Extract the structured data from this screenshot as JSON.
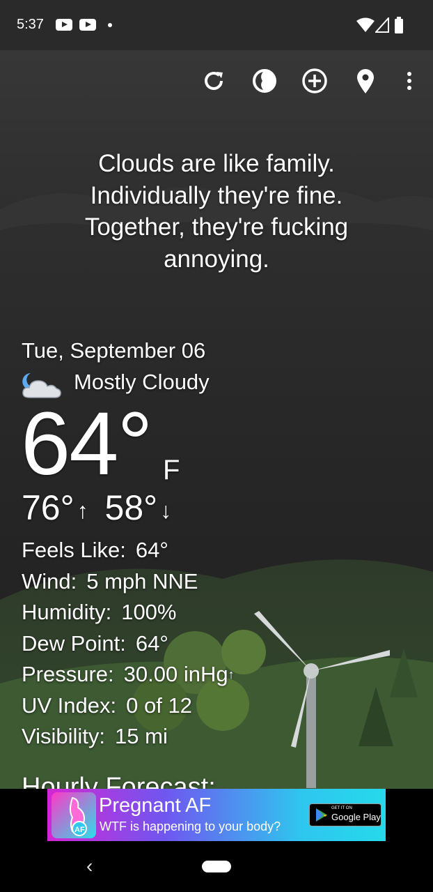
{
  "status_bar": {
    "time": "5:37"
  },
  "toolbar": {
    "icons": [
      "refresh-icon",
      "theme-icon",
      "add-location-icon",
      "location-pin-icon",
      "more-options-icon"
    ]
  },
  "quote": {
    "lines": [
      "Clouds are like family.",
      "Individually they're fine.",
      "Together, they're fucking",
      "annoying."
    ]
  },
  "weather": {
    "date": "Tue, September 06",
    "condition": "Mostly Cloudy",
    "condition_icon": "partly-cloudy-night-icon",
    "temperature": "64°",
    "unit": "F",
    "high": "76°",
    "low": "58°",
    "high_arrow": "↑",
    "low_arrow": "↓"
  },
  "details": [
    {
      "label": "Feels Like:",
      "value": "64°"
    },
    {
      "label": "Wind:",
      "value": "5 mph NNE"
    },
    {
      "label": "Humidity:",
      "value": "100%"
    },
    {
      "label": "Dew Point:",
      "value": "64°"
    },
    {
      "label": "Pressure:",
      "value": "30.00 inHg",
      "trend": "↑"
    },
    {
      "label": "UV Index:",
      "value": "0 of 12"
    },
    {
      "label": "Visibility:",
      "value": "15 mi"
    }
  ],
  "hourly_heading": "Hourly Forecast:",
  "ad": {
    "title": "Pregnant AF",
    "subtitle": "WTF is happening to your body?",
    "store_top": "GET IT ON",
    "store_name": "Google Play"
  },
  "nav": {
    "back": "‹"
  }
}
